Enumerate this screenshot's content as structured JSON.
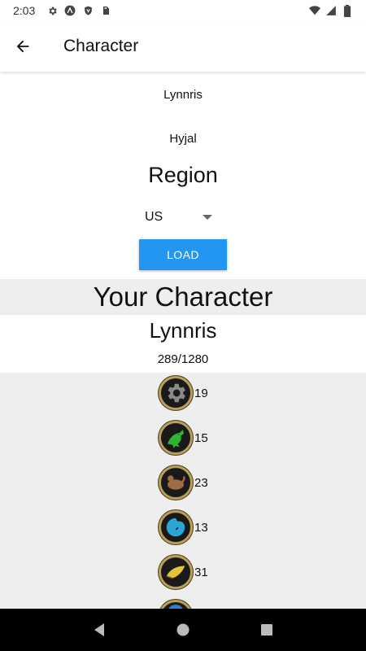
{
  "status_bar": {
    "time": "2:03",
    "left_icons": [
      "gear-icon",
      "a-icon",
      "shield-icon",
      "sd-card-icon"
    ],
    "right_icons": [
      "wifi-icon",
      "signal-icon",
      "battery-icon"
    ]
  },
  "app_bar": {
    "title": "Character",
    "back_icon": "arrow-back-icon"
  },
  "form": {
    "character_name": "Lynnris",
    "realm": "Hyjal",
    "region_heading": "Region",
    "region_value": "US",
    "load_label": "LOAD"
  },
  "result": {
    "heading": "Your Character",
    "name": "Lynnris",
    "progress": "289/1280"
  },
  "categories": [
    {
      "icon": "gear-category-icon",
      "count": "19",
      "color": "#8a8a8a"
    },
    {
      "icon": "dragon-category-icon",
      "count": "15",
      "color": "#2fb52f"
    },
    {
      "icon": "beast-category-icon",
      "count": "23",
      "color": "#a06a45"
    },
    {
      "icon": "swirl-category-icon",
      "count": "13",
      "color": "#2aa6d6"
    },
    {
      "icon": "feather-category-icon",
      "count": "31",
      "color": "#e6c23a"
    }
  ],
  "nav_bar": {
    "back": "triangle-back-icon",
    "home": "circle-home-icon",
    "recents": "square-recents-icon"
  },
  "colors": {
    "accent": "#2196F3",
    "band_gray": "#eeeeee",
    "icon_ring": "#b8a05a"
  }
}
